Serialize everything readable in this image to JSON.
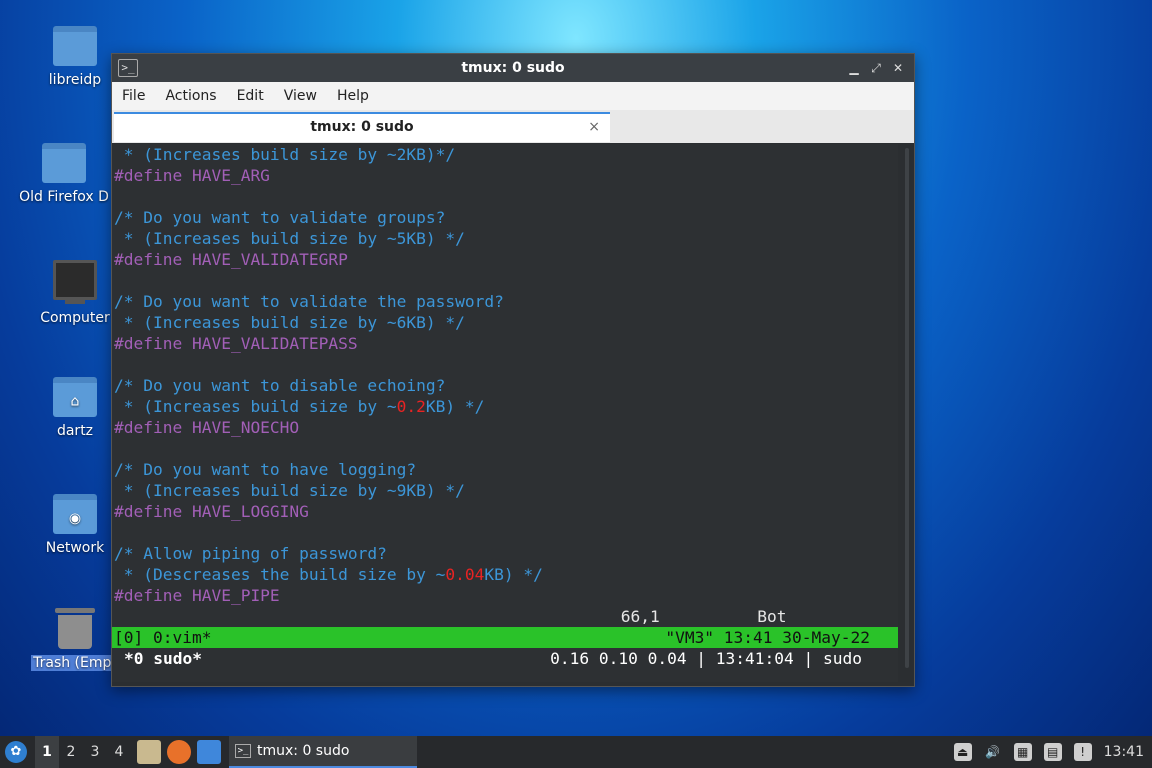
{
  "desktop": {
    "icons": [
      {
        "label": "libreidp",
        "icon": "folder-icon"
      },
      {
        "label": "Old Firefox D",
        "icon": "folder-icon"
      },
      {
        "label": "Computer",
        "icon": "computer-icon"
      },
      {
        "label": "dartz",
        "icon": "home-folder-icon"
      },
      {
        "label": "Network",
        "icon": "network-folder-icon"
      },
      {
        "label": "Trash (Empt",
        "icon": "trash-icon"
      }
    ]
  },
  "window": {
    "title": "tmux: 0 sudo",
    "menu": [
      "File",
      "Actions",
      "Edit",
      "View",
      "Help"
    ],
    "tab_label": "tmux: 0 sudo",
    "tab_close": "×"
  },
  "terminal": {
    "lines": [
      [
        {
          "t": " * (Increases build size by ~2KB)*/",
          "c": "c"
        }
      ],
      [
        {
          "t": "#define HAVE_ARG",
          "c": "d"
        }
      ],
      [],
      [
        {
          "t": "/* Do you want to validate groups?",
          "c": "c"
        }
      ],
      [
        {
          "t": " * (Increases build size by ~5KB) */",
          "c": "c"
        }
      ],
      [
        {
          "t": "#define HAVE_VALIDATEGRP",
          "c": "d"
        }
      ],
      [],
      [
        {
          "t": "/* Do you want to validate the password?",
          "c": "c"
        }
      ],
      [
        {
          "t": " * (Increases build size by ~6KB) */",
          "c": "c"
        }
      ],
      [
        {
          "t": "#define HAVE_VALIDATEPASS",
          "c": "d"
        }
      ],
      [],
      [
        {
          "t": "/* Do you want to disable echoing?",
          "c": "c"
        }
      ],
      [
        {
          "t": " * (Increases build size by ~",
          "c": "c"
        },
        {
          "t": "0.2",
          "c": "r"
        },
        {
          "t": "KB) */",
          "c": "c"
        }
      ],
      [
        {
          "t": "#define HAVE_NOECHO",
          "c": "d"
        }
      ],
      [],
      [
        {
          "t": "/* Do you want to have logging?",
          "c": "c"
        }
      ],
      [
        {
          "t": " * (Increases build size by ~9KB) */",
          "c": "c"
        }
      ],
      [
        {
          "t": "#define HAVE_LOGGING",
          "c": "d"
        }
      ],
      [],
      [
        {
          "t": "/* Allow piping of password?",
          "c": "c"
        }
      ],
      [
        {
          "t": " * (Descreases the build size by ~",
          "c": "c"
        },
        {
          "t": "0.04",
          "c": "r"
        },
        {
          "t": "KB) */",
          "c": "c"
        }
      ],
      [
        {
          "t": "#define HAVE_PIPE",
          "c": "d"
        }
      ]
    ],
    "ruler": "                                                    66,1          Bot",
    "tmux_left": "[0] 0:vim*",
    "tmux_right": "\"VM3\" 13:41 30-May-22",
    "status_left": "*0 sudo*",
    "status_right": "0.16 0.10 0.04 | 13:41:04 | sudo"
  },
  "taskbar": {
    "workspaces": [
      "1",
      "2",
      "3",
      "4"
    ],
    "task_label": "tmux: 0 sudo",
    "clock": "13:41"
  }
}
